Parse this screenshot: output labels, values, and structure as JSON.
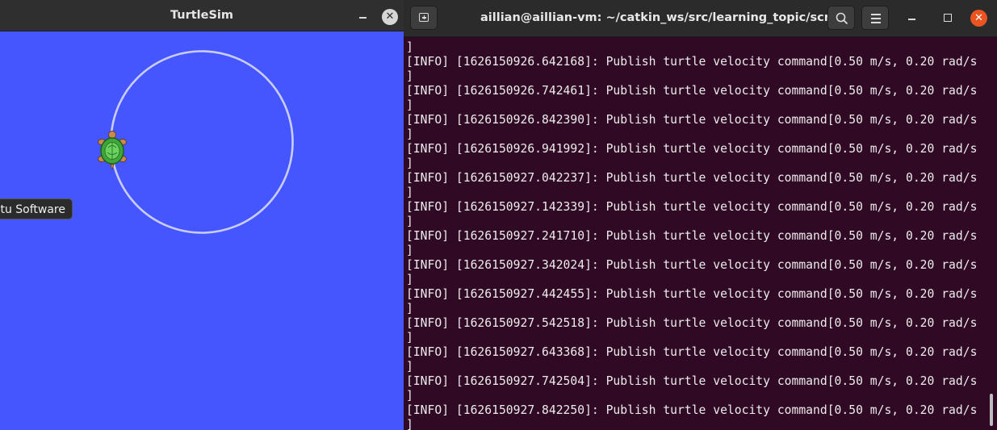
{
  "turtlesim": {
    "title": "TurtleSim",
    "minimize_glyph": "",
    "close_glyph": "✕",
    "background_color": "#4556ff",
    "path_color": "#c8ccff",
    "turtle_icon": "turtle-icon",
    "tooltip": "Ubuntu Software"
  },
  "terminal": {
    "title": "aillian@aillian-vm: ~/catkin_ws/src/learning_topic/scripts",
    "background_color": "#300a24",
    "close_glyph": "✕",
    "lines": [
      "]",
      "[INFO] [1626150926.642168]: Publish turtle velocity command[0.50 m/s, 0.20 rad/s",
      "]",
      "[INFO] [1626150926.742461]: Publish turtle velocity command[0.50 m/s, 0.20 rad/s",
      "]",
      "[INFO] [1626150926.842390]: Publish turtle velocity command[0.50 m/s, 0.20 rad/s",
      "]",
      "[INFO] [1626150926.941992]: Publish turtle velocity command[0.50 m/s, 0.20 rad/s",
      "]",
      "[INFO] [1626150927.042237]: Publish turtle velocity command[0.50 m/s, 0.20 rad/s",
      "]",
      "[INFO] [1626150927.142339]: Publish turtle velocity command[0.50 m/s, 0.20 rad/s",
      "]",
      "[INFO] [1626150927.241710]: Publish turtle velocity command[0.50 m/s, 0.20 rad/s",
      "]",
      "[INFO] [1626150927.342024]: Publish turtle velocity command[0.50 m/s, 0.20 rad/s",
      "]",
      "[INFO] [1626150927.442455]: Publish turtle velocity command[0.50 m/s, 0.20 rad/s",
      "]",
      "[INFO] [1626150927.542518]: Publish turtle velocity command[0.50 m/s, 0.20 rad/s",
      "]",
      "[INFO] [1626150927.643368]: Publish turtle velocity command[0.50 m/s, 0.20 rad/s",
      "]",
      "[INFO] [1626150927.742504]: Publish turtle velocity command[0.50 m/s, 0.20 rad/s",
      "]",
      "[INFO] [1626150927.842250]: Publish turtle velocity command[0.50 m/s, 0.20 rad/s",
      "]"
    ]
  }
}
